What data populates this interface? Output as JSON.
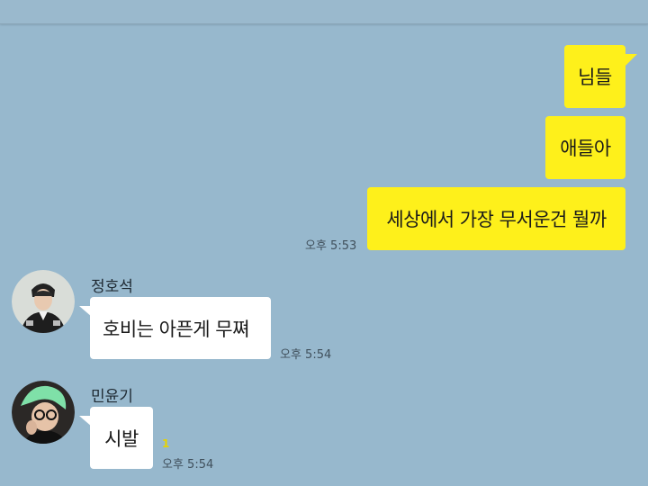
{
  "sent_messages": [
    {
      "text": "님들"
    },
    {
      "text": "애들아"
    },
    {
      "text": "세상에서 가장 무서운건 뭘까",
      "time": "오후 5:53"
    }
  ],
  "received_messages": [
    {
      "sender": "정호석",
      "text": "호비는 아픈게 무쪄",
      "time": "오후 5:54"
    },
    {
      "sender": "민윤기",
      "text": "시발",
      "time": "오후 5:54",
      "unread": "1"
    }
  ],
  "colors": {
    "background": "#97b8cd",
    "my_bubble": "#fef01b",
    "their_bubble": "#ffffff",
    "unread": "#e6d300"
  }
}
